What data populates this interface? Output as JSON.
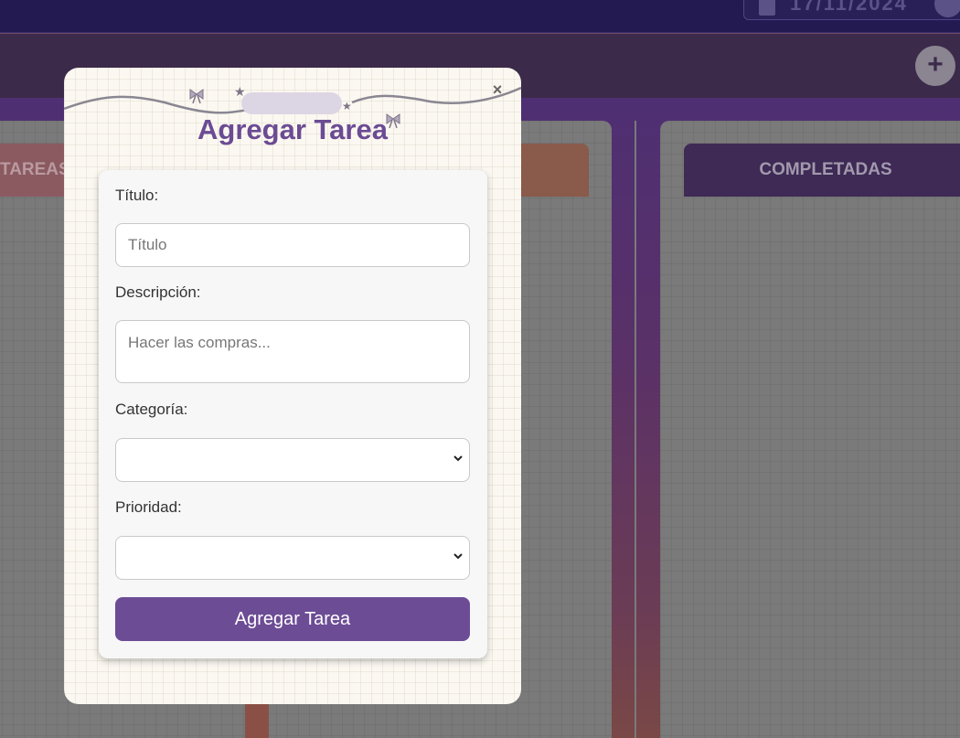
{
  "header": {
    "date_value": "17/11/2024"
  },
  "columns": {
    "todo_label": "TAREAS",
    "done_label": "COMPLETADAS"
  },
  "modal": {
    "title": "Agregar Tarea",
    "close_label": "×",
    "fields": {
      "title_label": "Título:",
      "title_placeholder": "Título",
      "description_label": "Descripción:",
      "description_placeholder": "Hacer las compras...",
      "category_label": "Categoría:",
      "category_value": "",
      "priority_label": "Prioridad:",
      "priority_value": ""
    },
    "submit_label": "Agregar Tarea"
  },
  "icons": {
    "add": "plus-icon",
    "calendar": "calendar-icon",
    "clock": "clock-icon",
    "bow": "bow-icon",
    "star": "star-icon",
    "chevron": "chevron-down-icon"
  },
  "colors": {
    "accent": "#6d4c96",
    "title": "#6b4b93",
    "modal_bg": "#fbf8f1",
    "topbar": "#241a52"
  }
}
